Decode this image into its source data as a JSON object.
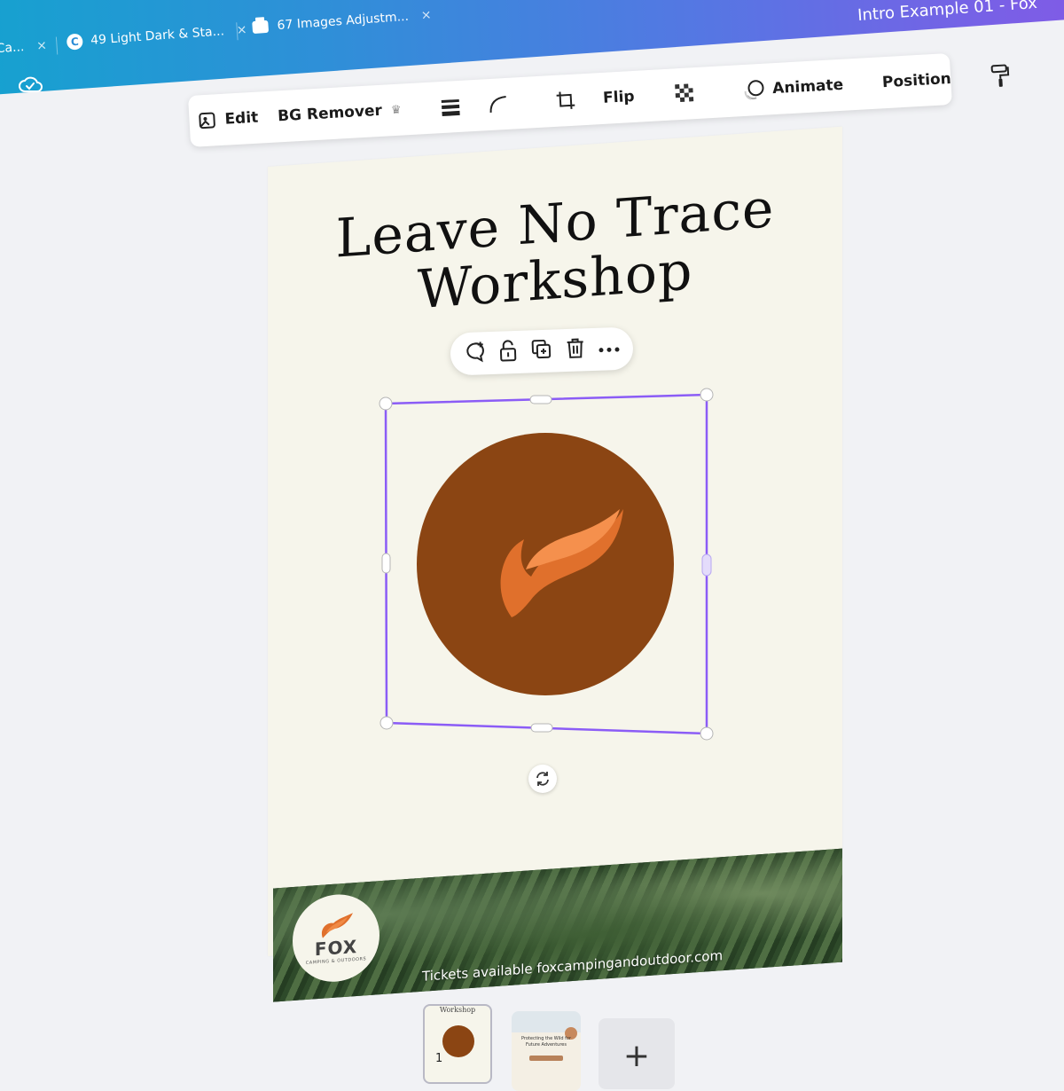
{
  "browser": {
    "tabs": [
      {
        "label": "Ca..."
      },
      {
        "label": "49 Light Dark & Sta..."
      },
      {
        "label": "67 Images Adjustm..."
      }
    ],
    "tab_close": "×",
    "favicon_letter": "C"
  },
  "header": {
    "doc_title": "Intro Example 01 - Fox",
    "gradient_colors": [
      "#14a3cf",
      "#8a55e6"
    ]
  },
  "toolbar": {
    "edit_label": "Edit",
    "bg_remover_label": "BG Remover",
    "crown_glyph": "♛",
    "flip_label": "Flip",
    "animate_label": "Animate",
    "position_label": "Position"
  },
  "design": {
    "title_line1": "Leave No Trace",
    "title_line2": "Workshop",
    "tickets_text": "Tickets available foxcampingandoutdoor.com",
    "logo_word": "FOX",
    "logo_sub": "CAMPING & OUTDOORS",
    "emblem_color": "#8b4513",
    "flame_colors": [
      "#f08a45",
      "#e0702c"
    ],
    "selection_color": "#8b5cf6",
    "background_color": "#f6f5eb"
  },
  "pages": {
    "thumb1_caption": "Workshop",
    "thumb1_number": "1",
    "thumb2_caption": "Protecting the Wild for Future Adventures",
    "add_label": "+"
  }
}
